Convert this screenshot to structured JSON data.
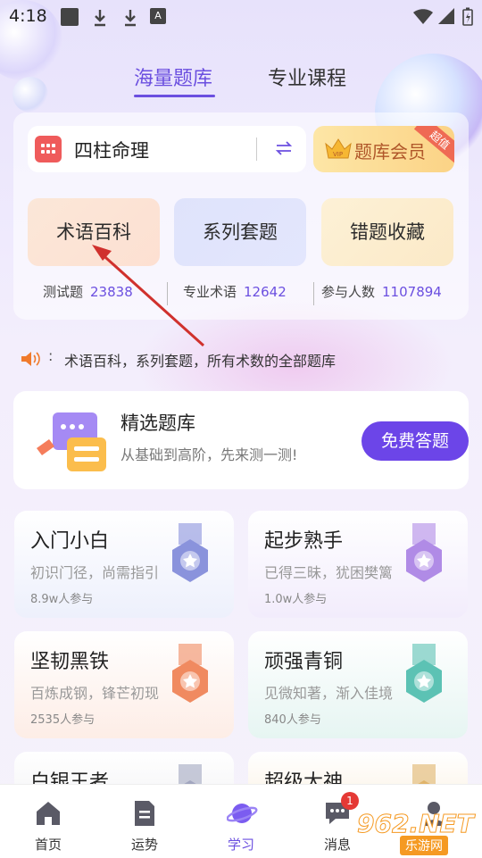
{
  "status_bar": {
    "time": "4:18",
    "a_icon": "A"
  },
  "top_tabs": [
    {
      "label": "海量题库",
      "active": true
    },
    {
      "label": "专业课程",
      "active": false
    }
  ],
  "category": {
    "label": "四柱命理",
    "icon": "calendar-grid-icon",
    "switch_icon": "swap-arrows-icon"
  },
  "vip": {
    "label": "题库会员",
    "badge": "超值",
    "icon": "vip-crown-icon"
  },
  "functions": [
    {
      "label": "术语百科"
    },
    {
      "label": "系列套题"
    },
    {
      "label": "错题收藏"
    }
  ],
  "stats": [
    {
      "label": "测试题",
      "value": "23838"
    },
    {
      "label": "专业术语",
      "value": "12642"
    },
    {
      "label": "参与人数",
      "value": "1107894"
    }
  ],
  "notice": {
    "colon": ":",
    "text": "术语百科，系列套题，所有术数的全部题库"
  },
  "featured": {
    "title": "精选题库",
    "subtitle": "从基础到高阶，先来测一测!",
    "button": "免费答题"
  },
  "levels": [
    {
      "title": "入门小白",
      "subtitle": "初识门径，尚需指引",
      "count": "8.9w人参与",
      "color": "#8a93dc"
    },
    {
      "title": "起步熟手",
      "subtitle": "已得三昧，犹困樊篱",
      "count": "1.0w人参与",
      "color": "#b08be6"
    },
    {
      "title": "坚韧黑铁",
      "subtitle": "百炼成钢，锋芒初现",
      "count": "2535人参与",
      "color": "#f08a60"
    },
    {
      "title": "顽强青铜",
      "subtitle": "见微知著，渐入佳境",
      "count": "840人参与",
      "color": "#5cc2b4"
    },
    {
      "title": "白银王者",
      "subtitle": "",
      "count": "",
      "color": "#a2a6bf"
    },
    {
      "title": "超级大神",
      "subtitle": "",
      "count": "",
      "color": "#e0b46a"
    }
  ],
  "bottom_nav": [
    {
      "label": "首页",
      "icon": "home-icon"
    },
    {
      "label": "运势",
      "icon": "document-icon"
    },
    {
      "label": "学习",
      "icon": "planet-icon",
      "active": true
    },
    {
      "label": "消息",
      "icon": "chat-icon",
      "badge": "1"
    },
    {
      "label": "",
      "icon": "user-icon"
    }
  ],
  "watermark": {
    "main": "962.NET",
    "sub": "乐游网"
  },
  "colors": {
    "accent": "#6b4fe0",
    "button": "#6c45e8",
    "badge": "#e53935"
  }
}
